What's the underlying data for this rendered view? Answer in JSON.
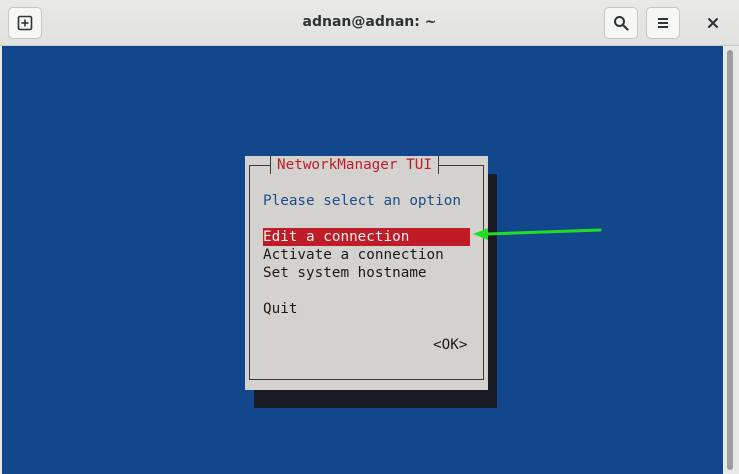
{
  "window": {
    "title": "adnan@adnan: ~"
  },
  "icons": {
    "new_tab": "new-tab-icon",
    "search": "search-icon",
    "menu": "hamburger-menu-icon",
    "close": "close-icon"
  },
  "dialog": {
    "title": "NetworkManager TUI",
    "prompt": "Please select an option",
    "items": [
      {
        "label": "Edit a connection",
        "selected": true
      },
      {
        "label": "Activate a connection",
        "selected": false
      },
      {
        "label": "Set system hostname",
        "selected": false
      },
      {
        "label": "Quit",
        "selected": false
      }
    ],
    "ok_label": "<OK>"
  },
  "colors": {
    "terminal_bg": "#12488b",
    "dialog_bg": "#d3d2cf",
    "selection": "#c01c28",
    "annotation_arrow": "#22dd22"
  }
}
